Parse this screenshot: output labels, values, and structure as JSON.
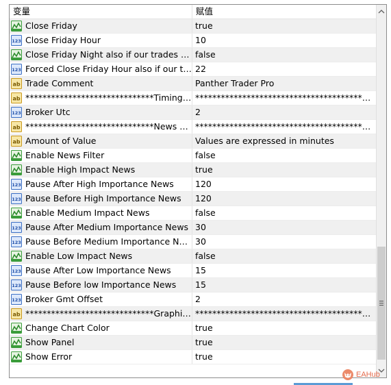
{
  "header": {
    "name_col": "变量",
    "value_col": "赋值"
  },
  "rows": [
    {
      "name": "Close Friday",
      "value": "true",
      "icon": "bool-icon"
    },
    {
      "name": "Close Friday Hour",
      "value": "10",
      "icon": "int-icon"
    },
    {
      "name": "Close Friday Night also if our trades are in loss",
      "value": "false",
      "icon": "bool-icon"
    },
    {
      "name": "Forced Close Friday Hour also if our trades are in loss",
      "value": "22",
      "icon": "int-icon"
    },
    {
      "name": "Trade Comment",
      "value": "Panther Trader Pro",
      "icon": "string-icon"
    },
    {
      "name": "******************************Timing******************************",
      "value": "****************************************************************",
      "icon": "string-icon"
    },
    {
      "name": "Broker Utc",
      "value": "2",
      "icon": "int-icon"
    },
    {
      "name": "******************************News Filter******************************",
      "value": "****************************************************************",
      "icon": "string-icon"
    },
    {
      "name": "Amount of Value",
      "value": "Values are expressed in minutes",
      "icon": "string-icon"
    },
    {
      "name": "Enable News Filter",
      "value": "false",
      "icon": "bool-icon"
    },
    {
      "name": "Enable High Impact News",
      "value": "true",
      "icon": "bool-icon"
    },
    {
      "name": "Pause After High Importance News",
      "value": "120",
      "icon": "int-icon"
    },
    {
      "name": "Pause Before High Importance News",
      "value": "120",
      "icon": "int-icon"
    },
    {
      "name": "Enable Medium Impact News",
      "value": "false",
      "icon": "bool-icon"
    },
    {
      "name": "Pause After Medium Importance News",
      "value": "30",
      "icon": "int-icon"
    },
    {
      "name": "Pause Before Medium Importance News",
      "value": "30",
      "icon": "int-icon"
    },
    {
      "name": "Enable Low Impact News",
      "value": "false",
      "icon": "bool-icon"
    },
    {
      "name": "Pause After Low Importance News",
      "value": "15",
      "icon": "int-icon"
    },
    {
      "name": "Pause Before low Importance News",
      "value": "15",
      "icon": "int-icon"
    },
    {
      "name": "Broker Gmt Offset",
      "value": "2",
      "icon": "int-icon"
    },
    {
      "name": "******************************Graphics******************************",
      "value": "****************************************************************",
      "icon": "string-icon"
    },
    {
      "name": "Change Chart Color",
      "value": "true",
      "icon": "bool-icon"
    },
    {
      "name": "Show Panel",
      "value": "true",
      "icon": "bool-icon"
    },
    {
      "name": "Show Error",
      "value": "true",
      "icon": "bool-icon"
    }
  ],
  "watermark": {
    "text": "EAHub",
    "icon": "fox-logo-icon"
  },
  "colors": {
    "bool_icon": "#3a9c3a",
    "int_icon": "#3b6fc4",
    "string_icon": "#d4a72c",
    "watermark": "#e46a4b"
  }
}
